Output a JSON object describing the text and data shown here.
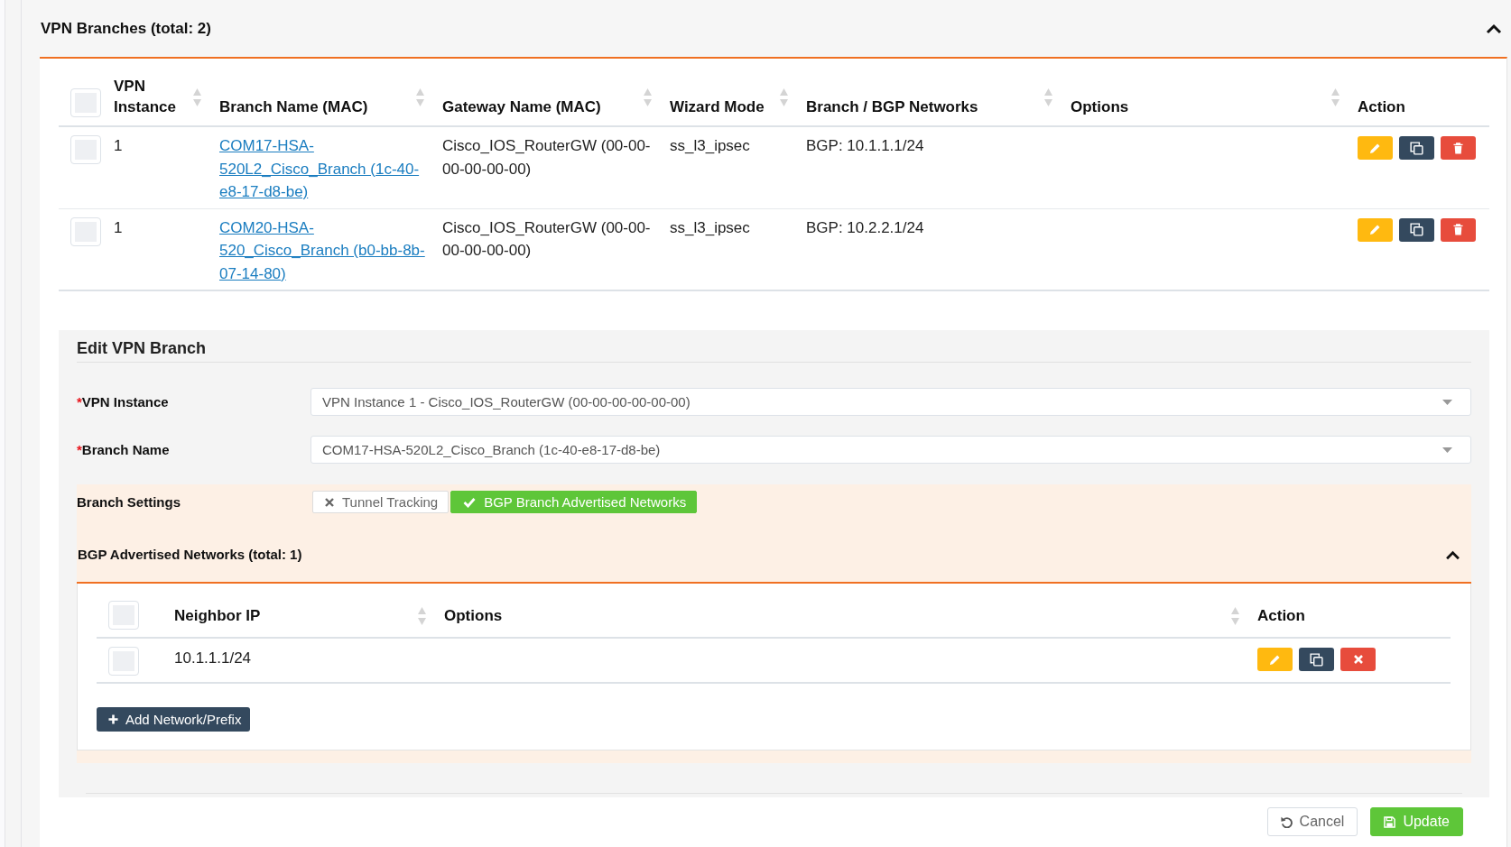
{
  "branches_panel": {
    "title": "VPN Branches (total: 2)",
    "expanded": true,
    "table": {
      "select_all_checked": false,
      "columns": [
        {
          "label": "VPN Instance",
          "sortable": true
        },
        {
          "label": "Branch Name (MAC)",
          "sortable": true
        },
        {
          "label": "Gateway Name (MAC)",
          "sortable": true
        },
        {
          "label": "Wizard Mode",
          "sortable": true
        },
        {
          "label": "Branch / BGP Networks",
          "sortable": true
        },
        {
          "label": "Options",
          "sortable": true
        },
        {
          "label": "Action",
          "sortable": false
        }
      ],
      "rows": [
        {
          "checked": false,
          "vpn_instance": "1",
          "branch_name": "COM17-HSA-520L2_Cisco_Branch (1c-40-e8-17-d8-be)",
          "gateway_name": "Cisco_IOS_RouterGW (00-00-00-00-00-00)",
          "wizard_mode": "ss_l3_ipsec",
          "networks": "BGP: 10.1.1.1/24"
        },
        {
          "checked": false,
          "vpn_instance": "1",
          "branch_name": "COM20-HSA-520_Cisco_Branch (b0-bb-8b-07-14-80)",
          "gateway_name": "Cisco_IOS_RouterGW (00-00-00-00-00-00)",
          "wizard_mode": "ss_l3_ipsec",
          "networks": "BGP: 10.2.2.1/24"
        }
      ]
    }
  },
  "edit_form": {
    "title": "Edit VPN Branch",
    "fields": [
      {
        "required_mark": "*",
        "label": "VPN Instance",
        "value": "VPN Instance 1 - Cisco_IOS_RouterGW (00-00-00-00-00-00)"
      },
      {
        "required_mark": "*",
        "label": "Branch Name",
        "value": "COM17-HSA-520L2_Cisco_Branch (1c-40-e8-17-d8-be)"
      }
    ],
    "branch_settings": {
      "label": "Branch Settings",
      "toggles": [
        {
          "label": "Tunnel Tracking",
          "on": false
        },
        {
          "label": "BGP Branch Advertised Networks",
          "on": true
        }
      ]
    },
    "bgp_networks": {
      "title": "BGP Advertised Networks (total: 1)",
      "expanded": true,
      "table": {
        "select_all_checked": false,
        "columns": [
          {
            "label": "Neighbor IP",
            "sortable": true
          },
          {
            "label": "Options",
            "sortable": true
          },
          {
            "label": "Action",
            "sortable": false
          }
        ],
        "rows": [
          {
            "checked": false,
            "neighbor_ip": "10.1.1.1/24"
          }
        ]
      },
      "add_button": "Add Network/Prefix"
    },
    "buttons": [
      {
        "label": "Cancel",
        "kind": "cancel"
      },
      {
        "label": "Update",
        "kind": "submit"
      }
    ]
  }
}
